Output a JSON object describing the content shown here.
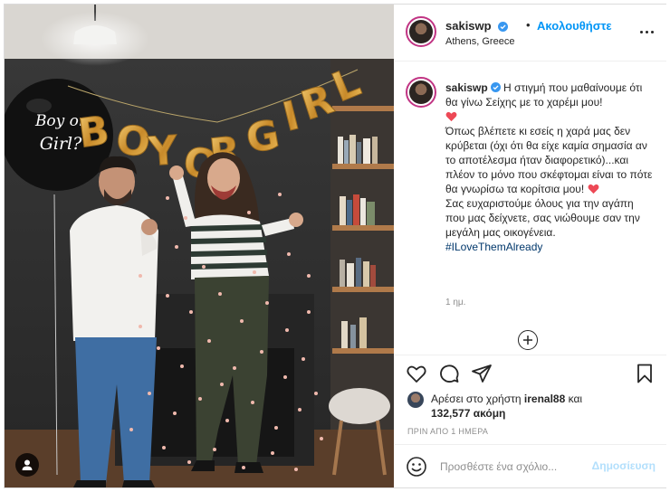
{
  "photo": {
    "alt_icon": "image-photo",
    "balloon_text_1": "Boy or",
    "balloon_text_2": "Girl?",
    "banner_text": "BOY OR GIRL",
    "tag_button_icon": "user-tag-icon"
  },
  "header": {
    "username": "sakiswp",
    "separator": "•",
    "follow_label": "Ακολουθήστε",
    "location": "Athens, Greece",
    "more_icon": "more-options-icon"
  },
  "caption": {
    "username": "sakiswp",
    "line1": "Η στιγμή που μαθαίνουμε ότι θα γίνω Σείχης με το χαρέμι μου!",
    "line2": "Όπως βλέπετε κι εσείς η χαρά μας δεν κρύβεται (όχι ότι θα είχε καμία σημασία αν το αποτέλεσμα ήταν διαφορετικό)...και πλέον το μόνο που σκέφτομαι είναι το πότε θα γνωρίσω τα κορίτσια μου!",
    "line3": "Σας ευχαριστούμε όλους για την αγάπη που μας δείχνετε, σας νιώθουμε σαν την μεγάλη μας οικογένεια.",
    "hashtag": "#ILoveThemAlready",
    "time_ago": "1 ημ."
  },
  "actions": {
    "like_icon": "heart-icon",
    "comment_icon": "comment-icon",
    "share_icon": "share-icon",
    "save_icon": "bookmark-icon"
  },
  "likes": {
    "prefix": "Αρέσει στο χρήστη",
    "liker": "irenal88",
    "conj": "και",
    "count": "132,577 ακόμη"
  },
  "posted": "ΠΡΙΝ ΑΠΟ 1 ΗΜΕΡΑ",
  "comment": {
    "placeholder": "Προσθέστε ένα σχόλιο...",
    "publish_label": "Δημοσίευση"
  },
  "colors": {
    "accent": "#0095f6",
    "publish_disabled": "#b2dffc",
    "verified": "#3897f0",
    "gold": "#d9a441",
    "heart_red": "#ed4956"
  }
}
